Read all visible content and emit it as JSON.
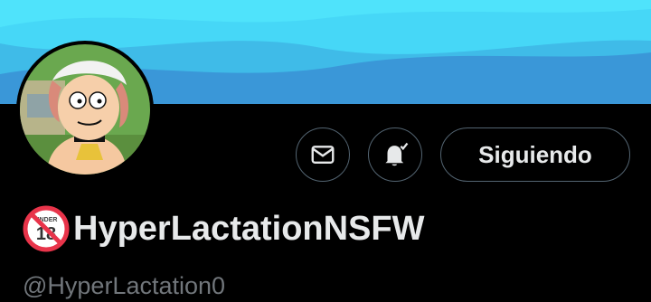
{
  "banner": {
    "colors": [
      "#4fe3fb",
      "#3fc6ea",
      "#3a97d8"
    ]
  },
  "profile": {
    "avatar_alt": "cartoon avatar",
    "display_name": "HyperLactationNSFW",
    "name_emoji": "under-18-prohibited-icon",
    "name_emoji_text": "UNDER",
    "name_emoji_number": "18",
    "handle": "@HyperLactation0"
  },
  "actions": {
    "message_icon": "envelope-icon",
    "notify_icon": "bell-check-icon",
    "follow_label": "Siguiendo"
  },
  "colors": {
    "background": "#000000",
    "text_primary": "#e7e9ea",
    "text_secondary": "#71767b",
    "button_border": "#536471"
  }
}
